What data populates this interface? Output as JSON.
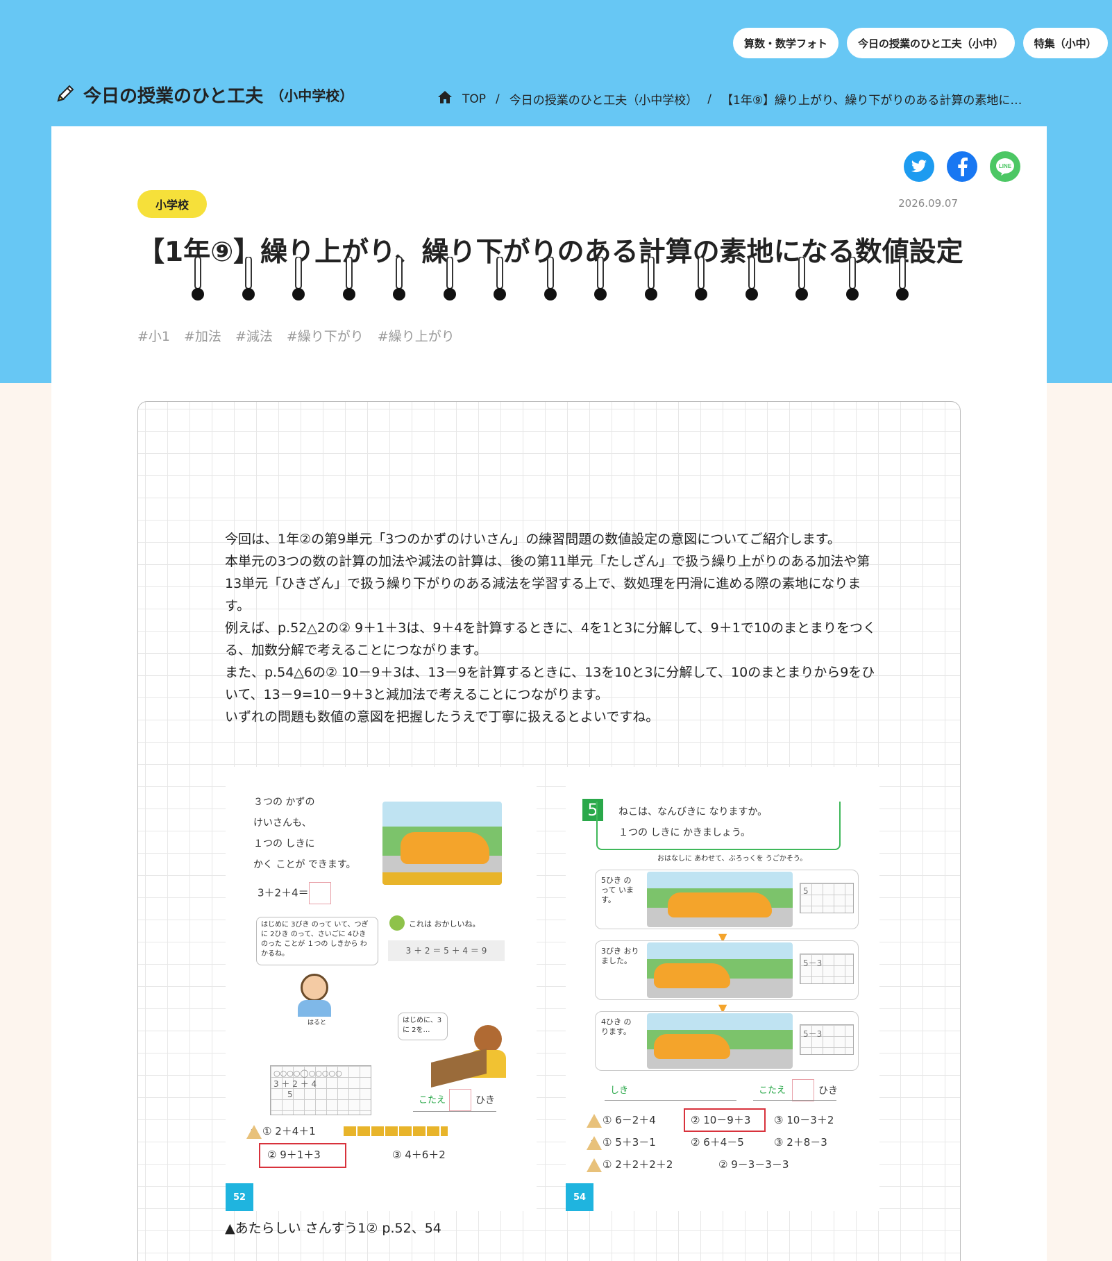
{
  "nav": {
    "pills": [
      "算数・数学フォト",
      "今日の授業のひと工夫（小中）",
      "特集（小中）"
    ]
  },
  "site": {
    "title_main": "今日の授業のひと工夫",
    "title_sub": "（小中学校）",
    "title_icon": "pencil-icon"
  },
  "breadcrumb": {
    "home_icon": "home-icon",
    "items": [
      "TOP",
      "今日の授業のひと工夫（小中学校）",
      "【1年⑨】繰り上がり、繰り下がりのある計算の素地に…"
    ],
    "separator": "/"
  },
  "share": {
    "buttons": [
      {
        "name": "twitter",
        "color": "#1d9bf0"
      },
      {
        "name": "facebook",
        "color": "#1877f2"
      },
      {
        "name": "line",
        "color": "#4cc764",
        "label": "LINE"
      }
    ]
  },
  "article": {
    "badge": "小学校",
    "date": "2026.09.07",
    "title": "【1年⑨】繰り上がり、繰り下がりのある計算の素地になる数値設定",
    "tags": [
      "#小1",
      "#加法",
      "#減法",
      "#繰り下がり",
      "#繰り上がり"
    ],
    "paragraphs": [
      "今回は、1年②の第9単元「3つのかずのけいさん」の練習問題の数値設定の意図についてご紹介します。",
      "本単元の3つの数の計算の加法や減法の計算は、後の第11単元「たしざん」で扱う繰り上がりのある加法や第13単元「ひきざん」で扱う繰り下がりのある減法を学習する上で、数処理を円滑に進める際の素地になります。",
      "例えば、p.52△2の② 9＋1＋3は、9＋4を計算するときに、4を1と3に分解して、9＋1で10のまとまりをつくる、加数分解で考えることにつながります。",
      "また、p.54△6の② 10－9＋3は、13－9を計算するときに、13を10と3に分解して、10のまとまりから9をひいて、13－9=10－9＋3と減加法で考えることにつながります。",
      "いずれの問題も数値の意図を把握したうえで丁寧に扱えるとよいですね。"
    ],
    "caption": "▲あたらしい さんすう1② p.52、54"
  },
  "textbook_left": {
    "intro_lines": [
      "３つの かずの",
      "けいさんも、",
      "１つの しきに",
      "かく ことが できます。"
    ],
    "equation": "3＋2＋4＝",
    "speech_haruto": "はじめに 3びき のって いて、つぎに 2ひき のって、さいごに 4ひき のった ことが １つの しきから わかるね。",
    "haruto_name": "はると",
    "speech_odd": "これは おかしいね。",
    "wrong_eq": "3 ＋ 2 ＝ 5 ＋ 4 ＝ 9",
    "speech_girl": "はじめに、3に 2を…",
    "notebook_eq": "3 ＋ 2 ＋ 4",
    "notebook_sub": "5",
    "answer_label": "こたえ",
    "answer_unit": "ひき",
    "ex_mark": "2",
    "ex1": "① 2＋4＋1",
    "ex2": "② 9＋1＋3",
    "ex3": "③ 4＋6＋2",
    "page": "52"
  },
  "textbook_right": {
    "problem_num": "5",
    "problem_line1": "ねこは、なんびきに なりますか。",
    "problem_line2": "１つの しきに かきましょう。",
    "hint": "おはなしに あわせて、ぶろっくを うごかそう。",
    "steps": [
      {
        "text": "5ひき のって います。",
        "box": "5"
      },
      {
        "text": "3びき おりました。",
        "box": "5－3"
      },
      {
        "text": "4ひき のります。",
        "box": "5－3"
      }
    ],
    "formula_label": "しき",
    "answer_label": "こたえ",
    "answer_unit": "ひき",
    "rows": [
      {
        "mark": "6",
        "items": [
          "① 6－2＋4",
          "② 10－9＋3",
          "③ 10－3＋2"
        ]
      },
      {
        "mark": "7",
        "items": [
          "① 5＋3－1",
          "② 6＋4－5",
          "③ 2＋8－3"
        ]
      },
      {
        "mark": "8",
        "items": [
          "① 2＋2＋2＋2",
          "② 9－3－3－3"
        ]
      }
    ],
    "page": "54"
  }
}
